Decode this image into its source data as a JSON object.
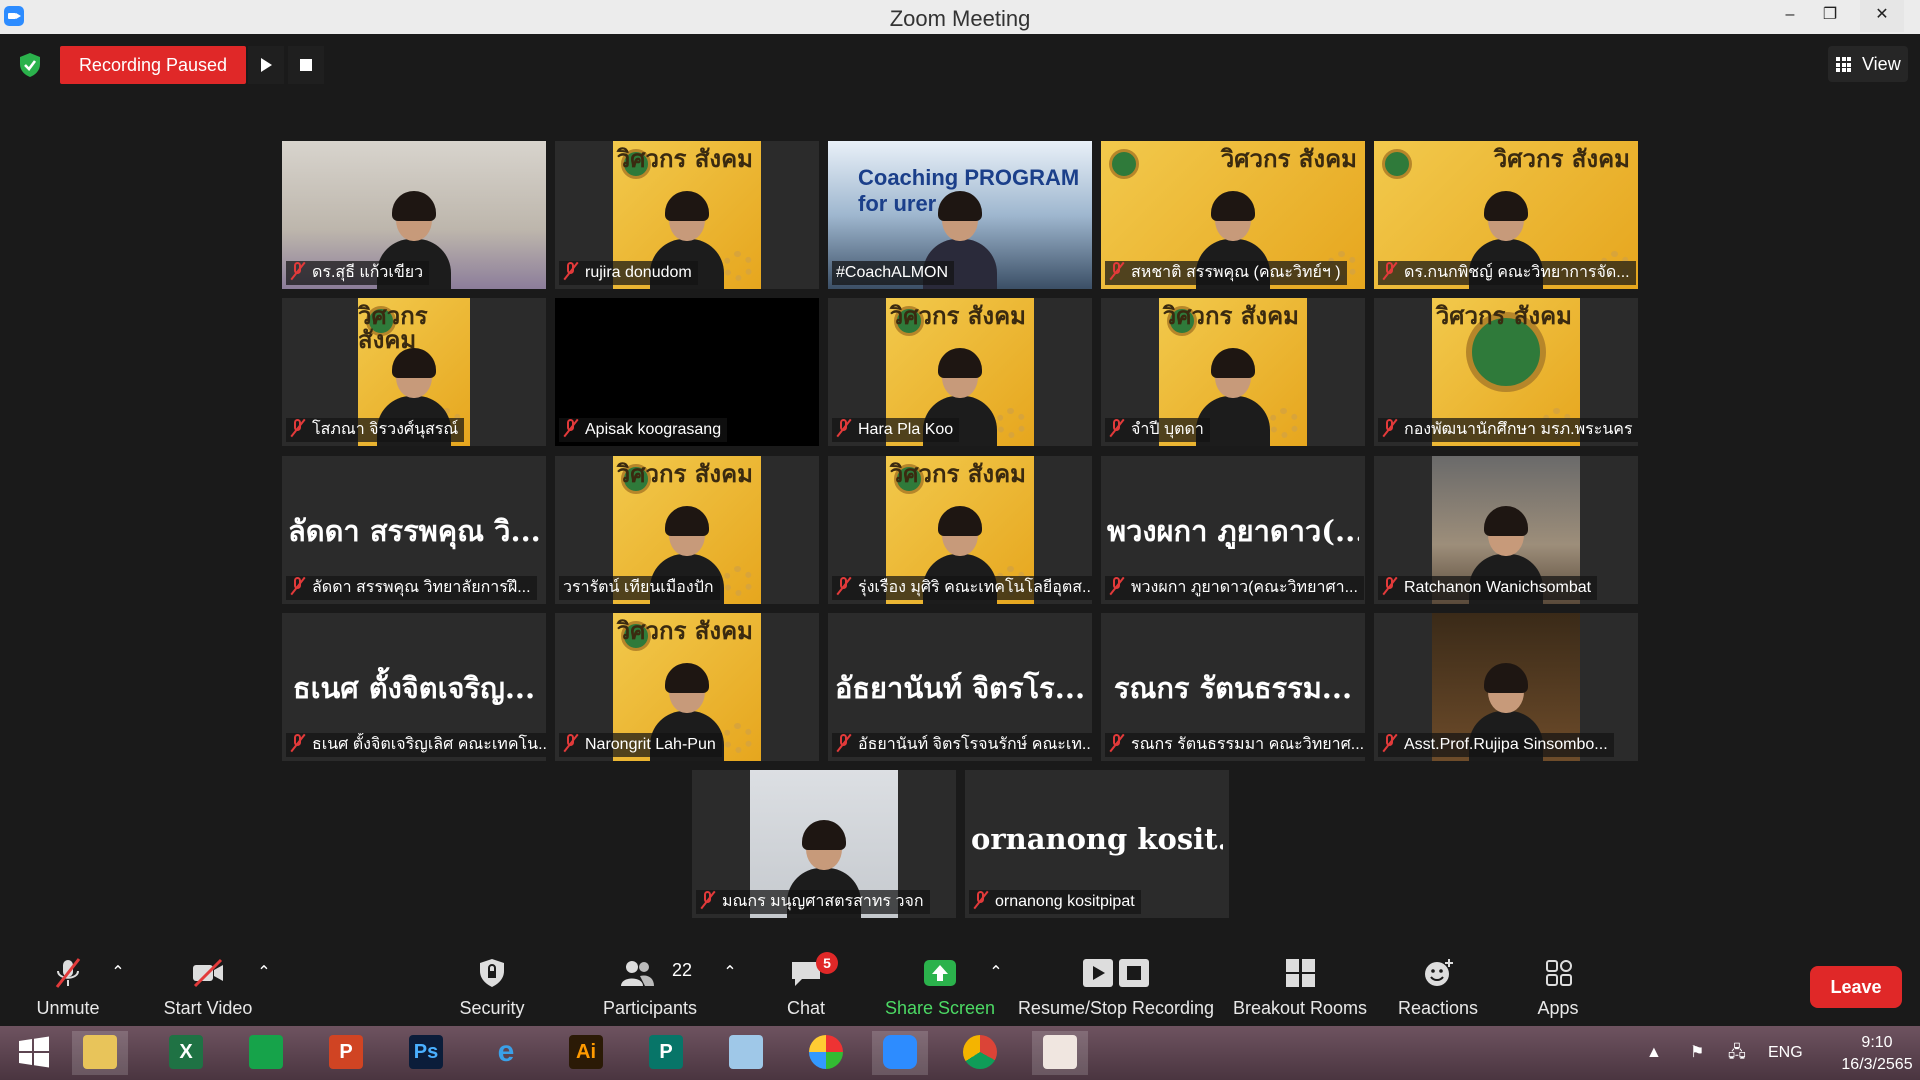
{
  "window": {
    "title": "Zoom Meeting",
    "minimize": "–",
    "maximize": "❐",
    "close": "✕"
  },
  "topbar": {
    "recording_status": "Recording Paused",
    "view_label": "View"
  },
  "participants": [
    {
      "name": "ดร.สุธี  แก้วเขียว",
      "video": "room",
      "muted": true
    },
    {
      "name": "rujira donudom",
      "video": "poster",
      "muted": true
    },
    {
      "name": "#CoachALMON",
      "video": "coach",
      "muted": false,
      "active_speaker": true,
      "overlay_text": "Coaching PROGRAM for urer"
    },
    {
      "name": "สหชาติ สรรพคุณ (คณะวิทย์ฯ )",
      "video": "poster",
      "muted": true
    },
    {
      "name": "ดร.กนกพิชญ์ คณะวิทยาการจัด...",
      "video": "poster",
      "muted": true
    },
    {
      "name": "โสภณา จิรวงศ์นุสรณ์",
      "video": "poster",
      "muted": true
    },
    {
      "name": "Apisak koograsang",
      "video": "black",
      "muted": true
    },
    {
      "name": "Hara Pla Koo",
      "video": "poster",
      "muted": true
    },
    {
      "name": "จำปี บุตดา",
      "video": "poster",
      "muted": true
    },
    {
      "name": "กองพัฒนานักศึกษา มรภ.พระนคร",
      "video": "poster-logo",
      "muted": true
    },
    {
      "name": "ลัดดา สรรพคุณ วิทยาลัยการฝึ...",
      "video": "none",
      "display_name": "ลัดดา สรรพคุณ วิ...",
      "muted": true
    },
    {
      "name": "วรารัตน์ เทียนเมืองปัก",
      "video": "poster",
      "muted": false
    },
    {
      "name": "รุ่งเรือง มุศิริ คณะเทคโนโลยีอุตส...",
      "video": "poster",
      "muted": true
    },
    {
      "name": "พวงผกา ภูยาดาว(คณะวิทยาศา...",
      "video": "none",
      "display_name": "พวงผกา ภูยาดาว(...",
      "muted": true
    },
    {
      "name": "Ratchanon Wanichsombat",
      "video": "restaurant",
      "muted": true
    },
    {
      "name": "ธเนศ ตั้งจิตเจริญเลิศ คณะเทคโน...",
      "video": "none",
      "display_name": "ธเนศ ตั้งจิตเจริญ...",
      "muted": true
    },
    {
      "name": "Narongrit Lah-Pun",
      "video": "poster",
      "muted": true
    },
    {
      "name": "อัธยานันท์ จิตรโรจนรักษ์ คณะเท...",
      "video": "none",
      "display_name": "อัธยานันท์ จิตรโร...",
      "muted": true
    },
    {
      "name": "รณกร รัตนธรรมมา คณะวิทยาศ...",
      "video": "none",
      "display_name": "รณกร รัตนธรรม...",
      "muted": true
    },
    {
      "name": "Asst.Prof.Rujipa Sinsombo...",
      "video": "office",
      "muted": true
    },
    {
      "name": "มณกร มนุญศาสตรสาทร วจก",
      "video": "white-room",
      "muted": true
    },
    {
      "name": "ornanong kositpipat",
      "video": "none",
      "display_name": "ornanong  kosit...",
      "muted": true
    }
  ],
  "poster_text": "วิศวกร สังคม",
  "toolbar": {
    "unmute": "Unmute",
    "start_video": "Start Video",
    "security": "Security",
    "participants": "Participants",
    "participants_count": "22",
    "chat": "Chat",
    "chat_badge": "5",
    "share_screen": "Share Screen",
    "record": "Resume/Stop Recording",
    "breakout": "Breakout Rooms",
    "reactions": "Reactions",
    "apps": "Apps",
    "leave": "Leave"
  },
  "taskbar": {
    "apps": [
      "windows-start",
      "file-explorer",
      "excel",
      "publisher-green",
      "powerpoint",
      "photoshop",
      "internet-explorer",
      "illustrator",
      "publisher",
      "notepad",
      "photoscape",
      "zoom",
      "chrome",
      "photo-viewer"
    ],
    "app_labels": {
      "excel": "X",
      "powerpoint": "P",
      "photoshop": "Ps",
      "illustrator": "Ai",
      "publisher": "P"
    },
    "language": "ENG",
    "time": "9:10",
    "date": "16/3/2565"
  },
  "colors": {
    "recording_red": "#e02828",
    "active_speaker": "#f3e640",
    "share_green": "#4cd964",
    "poster_yellow": "#f2c94c"
  }
}
